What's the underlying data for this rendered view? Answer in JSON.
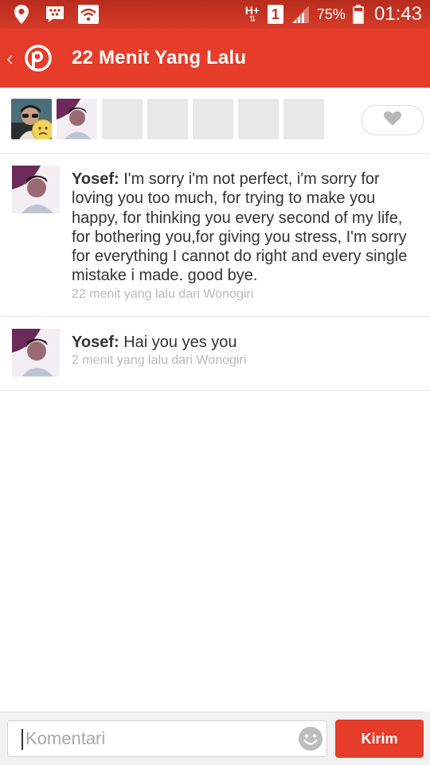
{
  "status_bar": {
    "network_type": "H+",
    "sim_slot": "1",
    "battery_percent": "75%",
    "time": "01:43",
    "icons": [
      "location-icon",
      "bbm-icon",
      "wifi-icon",
      "network-icon",
      "sim-icon",
      "signal-icon",
      "battery-icon"
    ]
  },
  "header": {
    "back_symbol": "‹",
    "app_logo_letter": "P",
    "title": "22 Menit Yang Lalu"
  },
  "viewers": {
    "avatars": [
      "avatar-viewer-1",
      "avatar-viewer-2"
    ],
    "empty_slots": 5,
    "love_icon": "heart-icon"
  },
  "comments": [
    {
      "author": "Yosef:",
      "text": " I'm sorry i'm not perfect, i'm sorry for loving you too much, for trying to make you happy, for thinking you every second of my life, for bothering you,for giving you stress, I'm sorry for everything I cannot do right and every single mistake i made. good bye.",
      "meta": "22 menit yang lalu dari Wonogiri"
    },
    {
      "author": "Yosef:",
      "text": " Hai you yes you",
      "meta": "2 menit yang lalu dari Wonogiri"
    }
  ],
  "composer": {
    "placeholder": "Komentari",
    "value": "",
    "send_label": "Kirim",
    "emoji_icon": "smiley-icon"
  },
  "colors": {
    "brand": "#e63c2a",
    "status_bar": "#c5321f",
    "meta_text": "#b9b9b9"
  }
}
